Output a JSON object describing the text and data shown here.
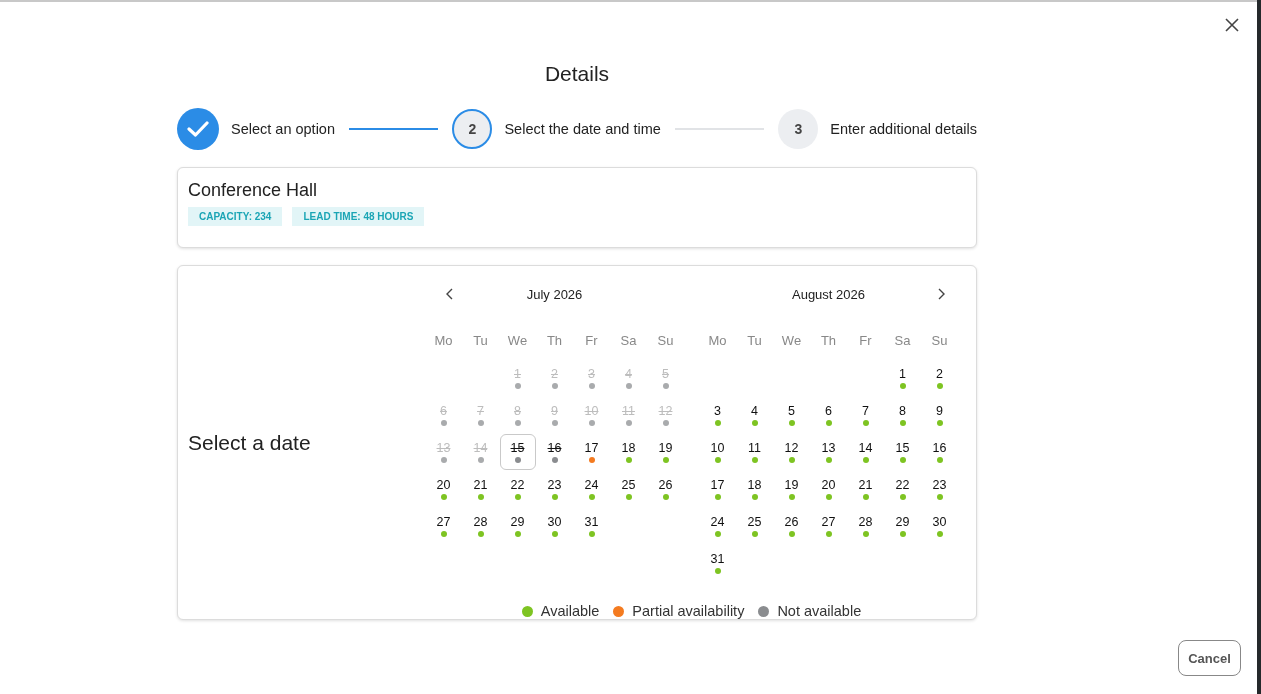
{
  "title": "Details",
  "steps": [
    {
      "label": "Select an option",
      "kind": "done"
    },
    {
      "number": "2",
      "label": "Select the date and time",
      "kind": "current"
    },
    {
      "number": "3",
      "label": "Enter additional details",
      "kind": "upcoming"
    }
  ],
  "resource": {
    "name": "Conference Hall",
    "tags": [
      "CAPACITY: 234",
      "LEAD TIME: 48 HOURS"
    ]
  },
  "date_section": {
    "label": "Select a date"
  },
  "months": [
    {
      "title": "July 2026",
      "weekdays": [
        "Mo",
        "Tu",
        "We",
        "Th",
        "Fr",
        "Sa",
        "Su"
      ],
      "weeks": [
        [
          {
            "day": "1",
            "color": "#a9abad",
            "disabled": true,
            "struck": true,
            "focused": false
          },
          {
            "day": "2",
            "color": "#a9abad",
            "disabled": true,
            "struck": true,
            "focused": false
          },
          {
            "day": "3",
            "color": "#a9abad",
            "disabled": true,
            "struck": true,
            "focused": false
          },
          {
            "day": "4",
            "color": "#a9abad",
            "disabled": true,
            "struck": true,
            "focused": false
          },
          {
            "day": "5",
            "color": "#a9abad",
            "disabled": true,
            "struck": true,
            "focused": false
          }
        ],
        [
          {
            "day": "6",
            "color": "#a9abad",
            "disabled": true,
            "struck": true,
            "focused": false
          },
          {
            "day": "7",
            "color": "#a9abad",
            "disabled": true,
            "struck": true,
            "focused": false
          },
          {
            "day": "8",
            "color": "#a9abad",
            "disabled": true,
            "struck": true,
            "focused": false
          },
          {
            "day": "9",
            "color": "#a9abad",
            "disabled": true,
            "struck": true,
            "focused": false
          },
          {
            "day": "10",
            "color": "#a9abad",
            "disabled": true,
            "struck": true,
            "focused": false
          },
          {
            "day": "11",
            "color": "#a9abad",
            "disabled": true,
            "struck": true,
            "focused": false
          },
          {
            "day": "12",
            "color": "#a9abad",
            "disabled": true,
            "struck": true,
            "focused": false
          }
        ],
        [
          {
            "day": "13",
            "color": "#a9abad",
            "disabled": true,
            "struck": true,
            "focused": false
          },
          {
            "day": "14",
            "color": "#a9abad",
            "disabled": true,
            "struck": true,
            "focused": false
          },
          {
            "day": "15",
            "color": "#8a8c8f",
            "disabled": false,
            "struck": true,
            "focused": true
          },
          {
            "day": "16",
            "color": "#8a8c8f",
            "disabled": false,
            "struck": true,
            "focused": false
          },
          {
            "day": "17",
            "color": "#f47b20",
            "disabled": false,
            "struck": false,
            "focused": false
          },
          {
            "day": "18",
            "color": "#7ec422",
            "disabled": false,
            "struck": false,
            "focused": false
          },
          {
            "day": "19",
            "color": "#7ec422",
            "disabled": false,
            "struck": false,
            "focused": false
          }
        ],
        [
          {
            "day": "20",
            "color": "#7ec422",
            "disabled": false,
            "struck": false,
            "focused": false
          },
          {
            "day": "21",
            "color": "#7ec422",
            "disabled": false,
            "struck": false,
            "focused": false
          },
          {
            "day": "22",
            "color": "#7ec422",
            "disabled": false,
            "struck": false,
            "focused": false
          },
          {
            "day": "23",
            "color": "#7ec422",
            "disabled": false,
            "struck": false,
            "focused": false
          },
          {
            "day": "24",
            "color": "#7ec422",
            "disabled": false,
            "struck": false,
            "focused": false
          },
          {
            "day": "25",
            "color": "#7ec422",
            "disabled": false,
            "struck": false,
            "focused": false
          },
          {
            "day": "26",
            "color": "#7ec422",
            "disabled": false,
            "struck": false,
            "focused": false
          }
        ],
        [
          {
            "day": "27",
            "color": "#7ec422",
            "disabled": false,
            "struck": false,
            "focused": false
          },
          {
            "day": "28",
            "color": "#7ec422",
            "disabled": false,
            "struck": false,
            "focused": false
          },
          {
            "day": "29",
            "color": "#7ec422",
            "disabled": false,
            "struck": false,
            "focused": false
          },
          {
            "day": "30",
            "color": "#7ec422",
            "disabled": false,
            "struck": false,
            "focused": false
          },
          {
            "day": "31",
            "color": "#7ec422",
            "disabled": false,
            "struck": false,
            "focused": false
          }
        ]
      ]
    },
    {
      "title": "August 2026",
      "weekdays": [
        "Mo",
        "Tu",
        "We",
        "Th",
        "Fr",
        "Sa",
        "Su"
      ],
      "weeks": [
        [
          {
            "day": "1",
            "color": "#7ec422",
            "disabled": false,
            "struck": false,
            "focused": false
          },
          {
            "day": "2",
            "color": "#7ec422",
            "disabled": false,
            "struck": false,
            "focused": false
          }
        ],
        [
          {
            "day": "3",
            "color": "#7ec422",
            "disabled": false,
            "struck": false,
            "focused": false
          },
          {
            "day": "4",
            "color": "#7ec422",
            "disabled": false,
            "struck": false,
            "focused": false
          },
          {
            "day": "5",
            "color": "#7ec422",
            "disabled": false,
            "struck": false,
            "focused": false
          },
          {
            "day": "6",
            "color": "#7ec422",
            "disabled": false,
            "struck": false,
            "focused": false
          },
          {
            "day": "7",
            "color": "#7ec422",
            "disabled": false,
            "struck": false,
            "focused": false
          },
          {
            "day": "8",
            "color": "#7ec422",
            "disabled": false,
            "struck": false,
            "focused": false
          },
          {
            "day": "9",
            "color": "#7ec422",
            "disabled": false,
            "struck": false,
            "focused": false
          }
        ],
        [
          {
            "day": "10",
            "color": "#7ec422",
            "disabled": false,
            "struck": false,
            "focused": false
          },
          {
            "day": "11",
            "color": "#7ec422",
            "disabled": false,
            "struck": false,
            "focused": false
          },
          {
            "day": "12",
            "color": "#7ec422",
            "disabled": false,
            "struck": false,
            "focused": false
          },
          {
            "day": "13",
            "color": "#7ec422",
            "disabled": false,
            "struck": false,
            "focused": false
          },
          {
            "day": "14",
            "color": "#7ec422",
            "disabled": false,
            "struck": false,
            "focused": false
          },
          {
            "day": "15",
            "color": "#7ec422",
            "disabled": false,
            "struck": false,
            "focused": false
          },
          {
            "day": "16",
            "color": "#7ec422",
            "disabled": false,
            "struck": false,
            "focused": false
          }
        ],
        [
          {
            "day": "17",
            "color": "#7ec422",
            "disabled": false,
            "struck": false,
            "focused": false
          },
          {
            "day": "18",
            "color": "#7ec422",
            "disabled": false,
            "struck": false,
            "focused": false
          },
          {
            "day": "19",
            "color": "#7ec422",
            "disabled": false,
            "struck": false,
            "focused": false
          },
          {
            "day": "20",
            "color": "#7ec422",
            "disabled": false,
            "struck": false,
            "focused": false
          },
          {
            "day": "21",
            "color": "#7ec422",
            "disabled": false,
            "struck": false,
            "focused": false
          },
          {
            "day": "22",
            "color": "#7ec422",
            "disabled": false,
            "struck": false,
            "focused": false
          },
          {
            "day": "23",
            "color": "#7ec422",
            "disabled": false,
            "struck": false,
            "focused": false
          }
        ],
        [
          {
            "day": "24",
            "color": "#7ec422",
            "disabled": false,
            "struck": false,
            "focused": false
          },
          {
            "day": "25",
            "color": "#7ec422",
            "disabled": false,
            "struck": false,
            "focused": false
          },
          {
            "day": "26",
            "color": "#7ec422",
            "disabled": false,
            "struck": false,
            "focused": false
          },
          {
            "day": "27",
            "color": "#7ec422",
            "disabled": false,
            "struck": false,
            "focused": false
          },
          {
            "day": "28",
            "color": "#7ec422",
            "disabled": false,
            "struck": false,
            "focused": false
          },
          {
            "day": "29",
            "color": "#7ec422",
            "disabled": false,
            "struck": false,
            "focused": false
          },
          {
            "day": "30",
            "color": "#7ec422",
            "disabled": false,
            "struck": false,
            "focused": false
          }
        ],
        [
          {
            "day": "31",
            "color": "#7ec422",
            "disabled": false,
            "struck": false,
            "focused": false
          }
        ]
      ]
    }
  ],
  "legend": [
    {
      "label": "Available",
      "color": "#7ec422"
    },
    {
      "label": "Partial availability",
      "color": "#f47b20"
    },
    {
      "label": "Not available",
      "color": "#8a8c8f"
    }
  ],
  "buttons": [
    {
      "label": "Cancel"
    }
  ]
}
